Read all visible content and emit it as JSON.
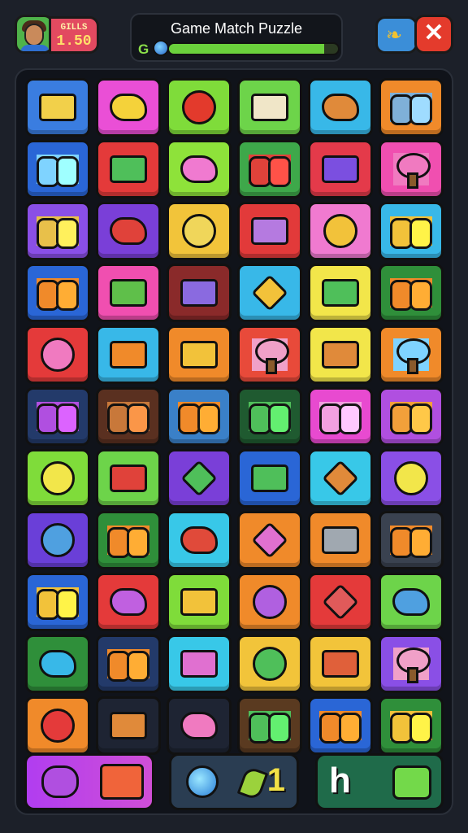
{
  "header": {
    "title": "Game Match Puzzle",
    "score_label": "GILLS",
    "score_value": "1.50",
    "gauge_letter": "G",
    "progress_fraction": 0.92
  },
  "board": {
    "tiles": [
      {
        "color": "#3a7de0",
        "icon": "box",
        "icon_color": "#f2d04a",
        "name": "gift-box-icon"
      },
      {
        "color": "#ea4fd6",
        "icon": "blob",
        "icon_color": "#f4d23a",
        "name": "bow-icon"
      },
      {
        "color": "#7fdc3a",
        "icon": "circle",
        "icon_color": "#e33a2c",
        "name": "apple-icon"
      },
      {
        "color": "#6dd44a",
        "icon": "box",
        "icon_color": "#f0e6c8",
        "name": "picture-icon"
      },
      {
        "color": "#38b8e8",
        "icon": "blob",
        "icon_color": "#e08a3a",
        "name": "basket-icon"
      },
      {
        "color": "#f08a2a",
        "icon": "pair",
        "icon_color": "#7fb0d8",
        "name": "jars-icon"
      },
      {
        "color": "#2a66d6",
        "icon": "pair",
        "icon_color": "#7fd3ff",
        "name": "flowers-icon"
      },
      {
        "color": "#e43a3a",
        "icon": "box",
        "icon_color": "#4fbf5a",
        "name": "garden-box-icon"
      },
      {
        "color": "#8ee23a",
        "icon": "blob",
        "icon_color": "#f07ad0",
        "name": "cat-icon"
      },
      {
        "color": "#3ea84a",
        "icon": "pair",
        "icon_color": "#e0423a",
        "name": "blocks-icon"
      },
      {
        "color": "#e43a4a",
        "icon": "box",
        "icon_color": "#7b4fe0",
        "name": "train-icon"
      },
      {
        "color": "#f04fb0",
        "icon": "tree",
        "icon_color": "#f07ac0",
        "name": "trees-icon"
      },
      {
        "color": "#8a4fe6",
        "icon": "pair",
        "icon_color": "#e8c04a",
        "name": "beans-icon"
      },
      {
        "color": "#7a3fd8",
        "icon": "blob",
        "icon_color": "#e0423a",
        "name": "cannon-icon"
      },
      {
        "color": "#f2c43a",
        "icon": "circle",
        "icon_color": "#f0d65a",
        "name": "smiley-icon"
      },
      {
        "color": "#e23a3a",
        "icon": "box",
        "icon_color": "#b57ae0",
        "name": "book-icon"
      },
      {
        "color": "#f07ad0",
        "icon": "circle",
        "icon_color": "#f2c23a",
        "name": "sun-icon"
      },
      {
        "color": "#38b8e8",
        "icon": "pair",
        "icon_color": "#f2c23a",
        "name": "phone-cup-icon"
      },
      {
        "color": "#2a66d6",
        "icon": "pair",
        "icon_color": "#f08a2a",
        "name": "socks-icon"
      },
      {
        "color": "#f04fb0",
        "icon": "box",
        "icon_color": "#5fbf4a",
        "name": "planter-icon"
      },
      {
        "color": "#8a2a2a",
        "icon": "box",
        "icon_color": "#8a6ae0",
        "name": "car-icon"
      },
      {
        "color": "#38b8e8",
        "icon": "diamond",
        "icon_color": "#f2c23a",
        "name": "candy-icon"
      },
      {
        "color": "#f2e64a",
        "icon": "box",
        "icon_color": "#4fbf5a",
        "name": "robot-icon"
      },
      {
        "color": "#2f8f3a",
        "icon": "pair",
        "icon_color": "#f08a2a",
        "name": "bells-icon"
      },
      {
        "color": "#e43a3a",
        "icon": "circle",
        "icon_color": "#f07ac0",
        "name": "lollipop-icon"
      },
      {
        "color": "#38b8e8",
        "icon": "box",
        "icon_color": "#f08a2a",
        "name": "camera-icon"
      },
      {
        "color": "#f08a2a",
        "icon": "box",
        "icon_color": "#f2c23a",
        "name": "tent-icon"
      },
      {
        "color": "#e84a3a",
        "icon": "tree",
        "icon_color": "#f0a0c8",
        "name": "bushes-icon"
      },
      {
        "color": "#f2e64a",
        "icon": "box",
        "icon_color": "#e08a3a",
        "name": "houses-icon"
      },
      {
        "color": "#f08a2a",
        "icon": "tree",
        "icon_color": "#7fd3ff",
        "name": "clouds-icon"
      },
      {
        "color": "#233a6a",
        "icon": "pair",
        "icon_color": "#b04fe0",
        "name": "shells-icon"
      },
      {
        "color": "#5a3020",
        "icon": "pair",
        "icon_color": "#c8783a",
        "name": "cookies-icon"
      },
      {
        "color": "#3a80c8",
        "icon": "pair",
        "icon_color": "#f08a2a",
        "name": "potions-icon"
      },
      {
        "color": "#1f5a30",
        "icon": "pair",
        "icon_color": "#4fbf5a",
        "name": "leaves-icon"
      },
      {
        "color": "#e84ad0",
        "icon": "pair",
        "icon_color": "#f2a0e0",
        "name": "bags-icon"
      },
      {
        "color": "#b04fe0",
        "icon": "pair",
        "icon_color": "#f2a03a",
        "name": "feathers-icon"
      },
      {
        "color": "#7fdc3a",
        "icon": "circle",
        "icon_color": "#f2e64a",
        "name": "chick-icon"
      },
      {
        "color": "#6dd44a",
        "icon": "box",
        "icon_color": "#e0423a",
        "name": "bus-icon"
      },
      {
        "color": "#7a3fd8",
        "icon": "diamond",
        "icon_color": "#4fbf5a",
        "name": "gem-icon"
      },
      {
        "color": "#2a66d6",
        "icon": "box",
        "icon_color": "#4fbf5a",
        "name": "cube-icon"
      },
      {
        "color": "#38c8e8",
        "icon": "diamond",
        "icon_color": "#e08a3a",
        "name": "crossed-sticks-icon"
      },
      {
        "color": "#8a4fe6",
        "icon": "circle",
        "icon_color": "#f2e64a",
        "name": "ball-icon"
      },
      {
        "color": "#6a3fd8",
        "icon": "circle",
        "icon_color": "#4fa0e0",
        "name": "yarn-icon"
      },
      {
        "color": "#2f8f3a",
        "icon": "pair",
        "icon_color": "#f08a2a",
        "name": "bottles-icon"
      },
      {
        "color": "#38c8e8",
        "icon": "blob",
        "icon_color": "#e04a3a",
        "name": "heart-icon"
      },
      {
        "color": "#f08a2a",
        "icon": "diamond",
        "icon_color": "#e070d0",
        "name": "bag-icon"
      },
      {
        "color": "#f08a2a",
        "icon": "box",
        "icon_color": "#a0a8b0",
        "name": "drawer-icon"
      },
      {
        "color": "#3a4250",
        "icon": "pair",
        "icon_color": "#f08a2a",
        "name": "knots-icon"
      },
      {
        "color": "#2a66d6",
        "icon": "pair",
        "icon_color": "#f2c23a",
        "name": "numbers-icon"
      },
      {
        "color": "#e43a3a",
        "icon": "blob",
        "icon_color": "#c060e0",
        "name": "fish-icon"
      },
      {
        "color": "#7fdc3a",
        "icon": "box",
        "icon_color": "#f2c23a",
        "name": "pot-icon"
      },
      {
        "color": "#f08a2a",
        "icon": "circle",
        "icon_color": "#b060e0",
        "name": "planet-icon"
      },
      {
        "color": "#e43a3a",
        "icon": "diamond",
        "icon_color": "#e05a5a",
        "name": "shield-icon"
      },
      {
        "color": "#6dd44a",
        "icon": "blob",
        "icon_color": "#4fa0e0",
        "name": "scooter-icon"
      },
      {
        "color": "#2f8f3a",
        "icon": "blob",
        "icon_color": "#38b8e8",
        "name": "key-icon"
      },
      {
        "color": "#233a6a",
        "icon": "pair",
        "icon_color": "#f08a2a",
        "name": "fruits-icon"
      },
      {
        "color": "#38c8e8",
        "icon": "box",
        "icon_color": "#e070d0",
        "name": "castle-icon"
      },
      {
        "color": "#f2c43a",
        "icon": "circle",
        "icon_color": "#4fbf5a",
        "name": "wheel-icon"
      },
      {
        "color": "#f2c43a",
        "icon": "box",
        "icon_color": "#e0603a",
        "name": "radio-icon"
      },
      {
        "color": "#8a4fe6",
        "icon": "tree",
        "icon_color": "#f0a0c8",
        "name": "balloons-icon"
      },
      {
        "color": "#f08a2a",
        "icon": "circle",
        "icon_color": "#e43a3a",
        "name": "donut-icon"
      },
      {
        "color": "#1e2433",
        "icon": "box",
        "icon_color": "#e08a3a",
        "name": "tv-icon"
      },
      {
        "color": "#1e2433",
        "icon": "blob",
        "icon_color": "#f07ac0",
        "name": "pig-icon"
      },
      {
        "color": "#5a3a20",
        "icon": "pair",
        "icon_color": "#4fbf5a",
        "name": "can-pear-icon"
      },
      {
        "color": "#2a66d6",
        "icon": "pair",
        "icon_color": "#f08a2a",
        "name": "letters-icon"
      },
      {
        "color": "#2f8f3a",
        "icon": "pair",
        "icon_color": "#f2c23a",
        "name": "tools-icon"
      }
    ]
  },
  "footer": {
    "count_value": "1"
  },
  "colors": {
    "background": "#1c2029",
    "board": "#10131a",
    "progress_fill": "#6bd13c",
    "close_button": "#e43b2c"
  }
}
